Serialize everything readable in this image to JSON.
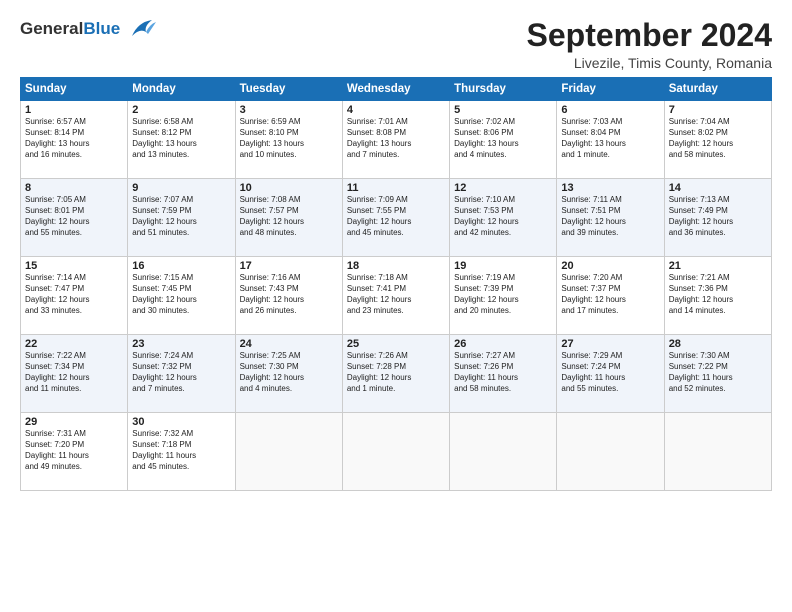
{
  "header": {
    "logo_line1": "General",
    "logo_line2": "Blue",
    "month": "September 2024",
    "location": "Livezile, Timis County, Romania"
  },
  "weekdays": [
    "Sunday",
    "Monday",
    "Tuesday",
    "Wednesday",
    "Thursday",
    "Friday",
    "Saturday"
  ],
  "weeks": [
    [
      {
        "day": "1",
        "info": "Sunrise: 6:57 AM\nSunset: 8:14 PM\nDaylight: 13 hours\nand 16 minutes."
      },
      {
        "day": "2",
        "info": "Sunrise: 6:58 AM\nSunset: 8:12 PM\nDaylight: 13 hours\nand 13 minutes."
      },
      {
        "day": "3",
        "info": "Sunrise: 6:59 AM\nSunset: 8:10 PM\nDaylight: 13 hours\nand 10 minutes."
      },
      {
        "day": "4",
        "info": "Sunrise: 7:01 AM\nSunset: 8:08 PM\nDaylight: 13 hours\nand 7 minutes."
      },
      {
        "day": "5",
        "info": "Sunrise: 7:02 AM\nSunset: 8:06 PM\nDaylight: 13 hours\nand 4 minutes."
      },
      {
        "day": "6",
        "info": "Sunrise: 7:03 AM\nSunset: 8:04 PM\nDaylight: 13 hours\nand 1 minute."
      },
      {
        "day": "7",
        "info": "Sunrise: 7:04 AM\nSunset: 8:02 PM\nDaylight: 12 hours\nand 58 minutes."
      }
    ],
    [
      {
        "day": "8",
        "info": "Sunrise: 7:05 AM\nSunset: 8:01 PM\nDaylight: 12 hours\nand 55 minutes."
      },
      {
        "day": "9",
        "info": "Sunrise: 7:07 AM\nSunset: 7:59 PM\nDaylight: 12 hours\nand 51 minutes."
      },
      {
        "day": "10",
        "info": "Sunrise: 7:08 AM\nSunset: 7:57 PM\nDaylight: 12 hours\nand 48 minutes."
      },
      {
        "day": "11",
        "info": "Sunrise: 7:09 AM\nSunset: 7:55 PM\nDaylight: 12 hours\nand 45 minutes."
      },
      {
        "day": "12",
        "info": "Sunrise: 7:10 AM\nSunset: 7:53 PM\nDaylight: 12 hours\nand 42 minutes."
      },
      {
        "day": "13",
        "info": "Sunrise: 7:11 AM\nSunset: 7:51 PM\nDaylight: 12 hours\nand 39 minutes."
      },
      {
        "day": "14",
        "info": "Sunrise: 7:13 AM\nSunset: 7:49 PM\nDaylight: 12 hours\nand 36 minutes."
      }
    ],
    [
      {
        "day": "15",
        "info": "Sunrise: 7:14 AM\nSunset: 7:47 PM\nDaylight: 12 hours\nand 33 minutes."
      },
      {
        "day": "16",
        "info": "Sunrise: 7:15 AM\nSunset: 7:45 PM\nDaylight: 12 hours\nand 30 minutes."
      },
      {
        "day": "17",
        "info": "Sunrise: 7:16 AM\nSunset: 7:43 PM\nDaylight: 12 hours\nand 26 minutes."
      },
      {
        "day": "18",
        "info": "Sunrise: 7:18 AM\nSunset: 7:41 PM\nDaylight: 12 hours\nand 23 minutes."
      },
      {
        "day": "19",
        "info": "Sunrise: 7:19 AM\nSunset: 7:39 PM\nDaylight: 12 hours\nand 20 minutes."
      },
      {
        "day": "20",
        "info": "Sunrise: 7:20 AM\nSunset: 7:37 PM\nDaylight: 12 hours\nand 17 minutes."
      },
      {
        "day": "21",
        "info": "Sunrise: 7:21 AM\nSunset: 7:36 PM\nDaylight: 12 hours\nand 14 minutes."
      }
    ],
    [
      {
        "day": "22",
        "info": "Sunrise: 7:22 AM\nSunset: 7:34 PM\nDaylight: 12 hours\nand 11 minutes."
      },
      {
        "day": "23",
        "info": "Sunrise: 7:24 AM\nSunset: 7:32 PM\nDaylight: 12 hours\nand 7 minutes."
      },
      {
        "day": "24",
        "info": "Sunrise: 7:25 AM\nSunset: 7:30 PM\nDaylight: 12 hours\nand 4 minutes."
      },
      {
        "day": "25",
        "info": "Sunrise: 7:26 AM\nSunset: 7:28 PM\nDaylight: 12 hours\nand 1 minute."
      },
      {
        "day": "26",
        "info": "Sunrise: 7:27 AM\nSunset: 7:26 PM\nDaylight: 11 hours\nand 58 minutes."
      },
      {
        "day": "27",
        "info": "Sunrise: 7:29 AM\nSunset: 7:24 PM\nDaylight: 11 hours\nand 55 minutes."
      },
      {
        "day": "28",
        "info": "Sunrise: 7:30 AM\nSunset: 7:22 PM\nDaylight: 11 hours\nand 52 minutes."
      }
    ],
    [
      {
        "day": "29",
        "info": "Sunrise: 7:31 AM\nSunset: 7:20 PM\nDaylight: 11 hours\nand 49 minutes."
      },
      {
        "day": "30",
        "info": "Sunrise: 7:32 AM\nSunset: 7:18 PM\nDaylight: 11 hours\nand 45 minutes."
      },
      {
        "day": "",
        "info": ""
      },
      {
        "day": "",
        "info": ""
      },
      {
        "day": "",
        "info": ""
      },
      {
        "day": "",
        "info": ""
      },
      {
        "day": "",
        "info": ""
      }
    ]
  ]
}
